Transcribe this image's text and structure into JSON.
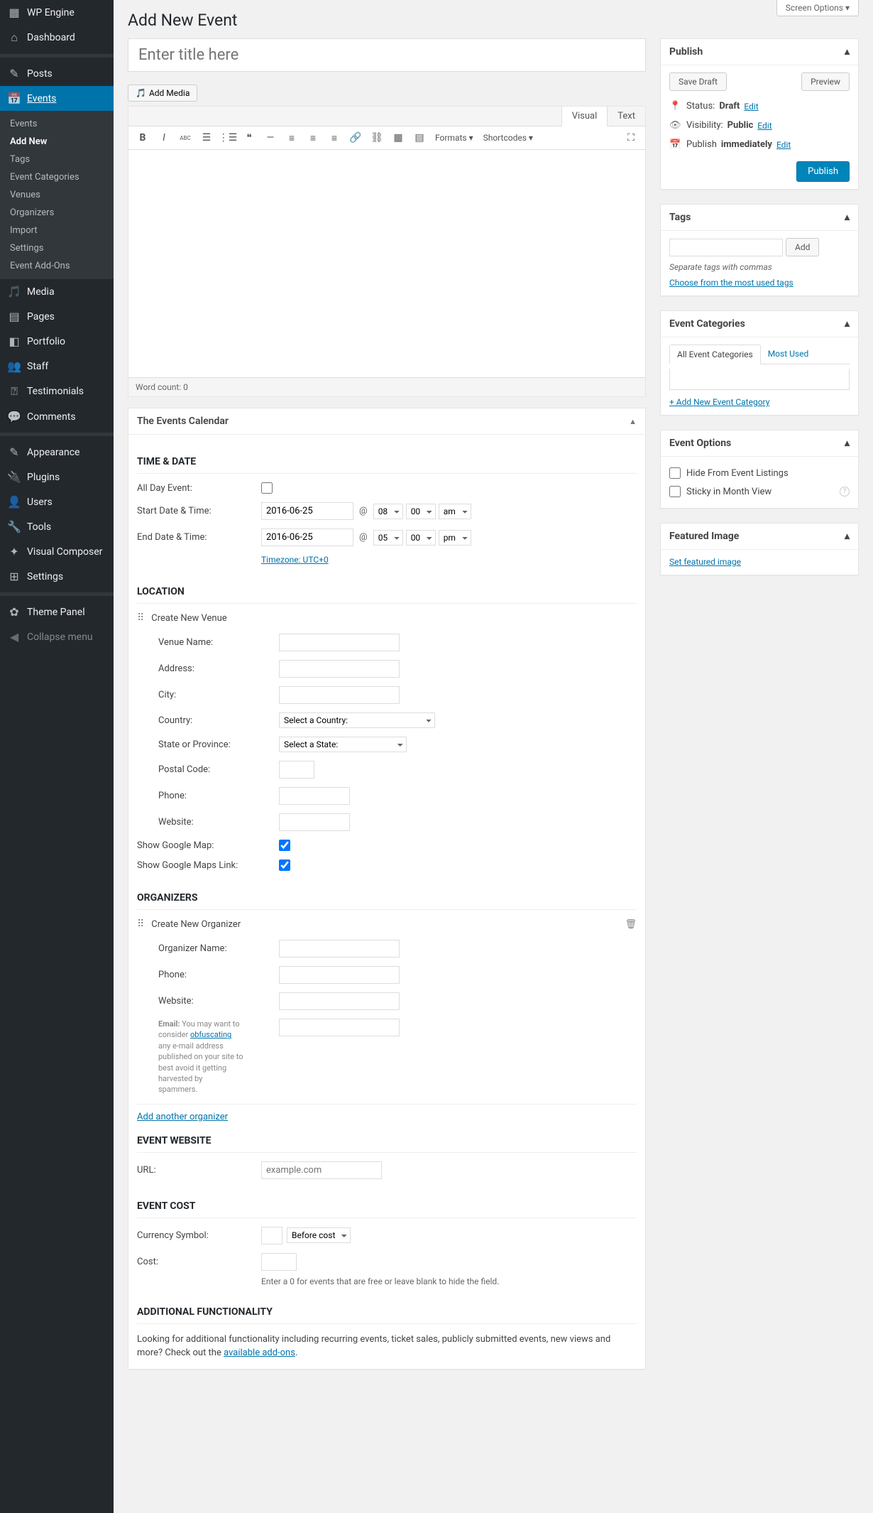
{
  "screenOptions": "Screen Options ▾",
  "pageTitle": "Add New Event",
  "titlePlaceholder": "Enter title here",
  "sidebar": {
    "items": [
      {
        "label": "WP Engine"
      },
      {
        "label": "Dashboard"
      },
      {
        "label": "Posts"
      },
      {
        "label": "Events"
      },
      {
        "label": "Media"
      },
      {
        "label": "Pages"
      },
      {
        "label": "Portfolio"
      },
      {
        "label": "Staff"
      },
      {
        "label": "Testimonials"
      },
      {
        "label": "Comments"
      },
      {
        "label": "Appearance"
      },
      {
        "label": "Plugins"
      },
      {
        "label": "Users"
      },
      {
        "label": "Tools"
      },
      {
        "label": "Visual Composer"
      },
      {
        "label": "Settings"
      },
      {
        "label": "Theme Panel"
      },
      {
        "label": "Collapse menu"
      }
    ],
    "sub": [
      "Events",
      "Add New",
      "Tags",
      "Event Categories",
      "Venues",
      "Organizers",
      "Import",
      "Settings",
      "Event Add-Ons"
    ]
  },
  "addMedia": "Add Media",
  "editorTabs": {
    "visual": "Visual",
    "text": "Text"
  },
  "toolbar": {
    "formats": "Formats ▾",
    "shortcodes": "Shortcodes ▾"
  },
  "wordCount": "Word count: 0",
  "eventsCal": {
    "title": "The Events Calendar",
    "timeDate": "TIME & DATE",
    "allDay": "All Day Event:",
    "startLabel": "Start Date & Time:",
    "endLabel": "End Date & Time:",
    "startDate": "2016-06-25",
    "endDate": "2016-06-25",
    "at": "@",
    "startHr": "08",
    "startMin": "00",
    "startAmpm": "am",
    "endHr": "05",
    "endMin": "00",
    "endAmpm": "pm",
    "timezone": "Timezone: UTC+0",
    "location": "LOCATION",
    "newVenue": "Create New Venue",
    "venueFields": {
      "name": "Venue Name:",
      "address": "Address:",
      "city": "City:",
      "country": "Country:",
      "state": "State or Province:",
      "postal": "Postal Code:",
      "phone": "Phone:",
      "website": "Website:"
    },
    "countrySel": "Select a Country:",
    "stateSel": "Select a State:",
    "gmap": "Show Google Map:",
    "gmapLink": "Show Google Maps Link:",
    "organizers": "ORGANIZERS",
    "newOrg": "Create New Organizer",
    "orgFields": {
      "name": "Organizer Name:",
      "phone": "Phone:",
      "website": "Website:",
      "email": "Email:"
    },
    "emailHint1": "You may want to consider ",
    "obf": "obfuscating",
    "emailHint2": " any e-mail address published on your site to best avoid it getting harvested by spammers.",
    "addOrg": "Add another organizer",
    "website": "EVENT WEBSITE",
    "urlLabel": "URL:",
    "urlPlaceholder": "example.com",
    "cost": "EVENT COST",
    "curSym": "Currency Symbol:",
    "beforeCost": "Before cost",
    "costLabel": "Cost:",
    "costHint": "Enter a 0 for events that are free or leave blank to hide the field.",
    "addFunc": "ADDITIONAL FUNCTIONALITY",
    "addFuncText1": "Looking for additional functionality including recurring events, ticket sales, publicly submitted events, new views and more? Check out the ",
    "addFuncLink": "available add-ons"
  },
  "publish": {
    "title": "Publish",
    "saveDraft": "Save Draft",
    "preview": "Preview",
    "status": "Status:",
    "statusVal": "Draft",
    "edit": "Edit",
    "visibility": "Visibility:",
    "visVal": "Public",
    "pubLabel": "Publish",
    "immediately": "immediately",
    "pubBtn": "Publish"
  },
  "tags": {
    "title": "Tags",
    "add": "Add",
    "hint": "Separate tags with commas",
    "choose": "Choose from the most used tags"
  },
  "cats": {
    "title": "Event Categories",
    "all": "All Event Categories",
    "most": "Most Used",
    "addNew": "+ Add New Event Category"
  },
  "opts": {
    "title": "Event Options",
    "hide": "Hide From Event Listings",
    "sticky": "Sticky in Month View"
  },
  "feat": {
    "title": "Featured Image",
    "set": "Set featured image"
  }
}
